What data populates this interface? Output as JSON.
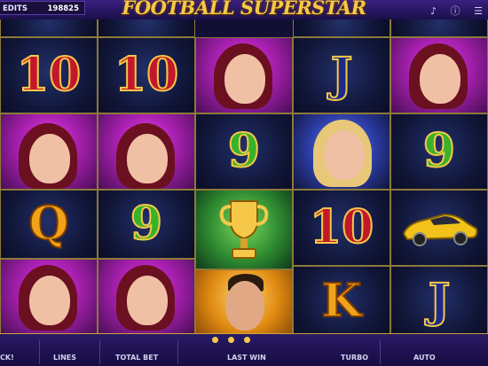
{
  "header": {
    "credits_label": "EDITS",
    "credits_value": "198825",
    "logo_text": "FOOTBALL SUPERSTAR"
  },
  "reels": [
    [
      {
        "symbol": "10",
        "type": "number",
        "color": "red"
      },
      {
        "symbol": "woman",
        "type": "picture"
      },
      {
        "symbol": "Q",
        "type": "letter",
        "color": "gold"
      },
      {
        "symbol": "woman",
        "type": "picture"
      }
    ],
    [
      {
        "symbol": "10",
        "type": "number",
        "color": "red"
      },
      {
        "symbol": "woman",
        "type": "picture"
      },
      {
        "symbol": "9",
        "type": "number",
        "color": "green"
      },
      {
        "symbol": "woman",
        "type": "picture"
      }
    ],
    [
      {
        "symbol": "woman",
        "type": "picture"
      },
      {
        "symbol": "9",
        "type": "number",
        "color": "green"
      },
      {
        "symbol": "trophy",
        "type": "picture"
      },
      {
        "symbol": "player",
        "type": "picture"
      }
    ],
    [
      {
        "symbol": "J",
        "type": "letter",
        "color": "blue"
      },
      {
        "symbol": "blonde-woman",
        "type": "picture"
      },
      {
        "symbol": "10",
        "type": "number",
        "color": "red"
      },
      {
        "symbol": "K",
        "type": "letter",
        "color": "gold"
      }
    ],
    [
      {
        "symbol": "woman",
        "type": "picture"
      },
      {
        "symbol": "9",
        "type": "number",
        "color": "green"
      },
      {
        "symbol": "sports-car",
        "type": "picture"
      },
      {
        "symbol": "J",
        "type": "letter",
        "color": "blue"
      }
    ]
  ],
  "footer": {
    "left_label": "CK!",
    "lines_label": "LINES",
    "total_bet_label": "TOTAL BET",
    "last_win_label": "LAST WIN",
    "turbo_label": "TURBO",
    "auto_label": "AUTO"
  },
  "colors": {
    "gold": "#f5c84a",
    "red": "#c2182a",
    "green": "#39b22a",
    "blue": "#1d2a8a",
    "frame": "#8c7a3a"
  },
  "icons": [
    "sound-icon",
    "info-icon",
    "menu-icon",
    "spin-button-icon"
  ]
}
